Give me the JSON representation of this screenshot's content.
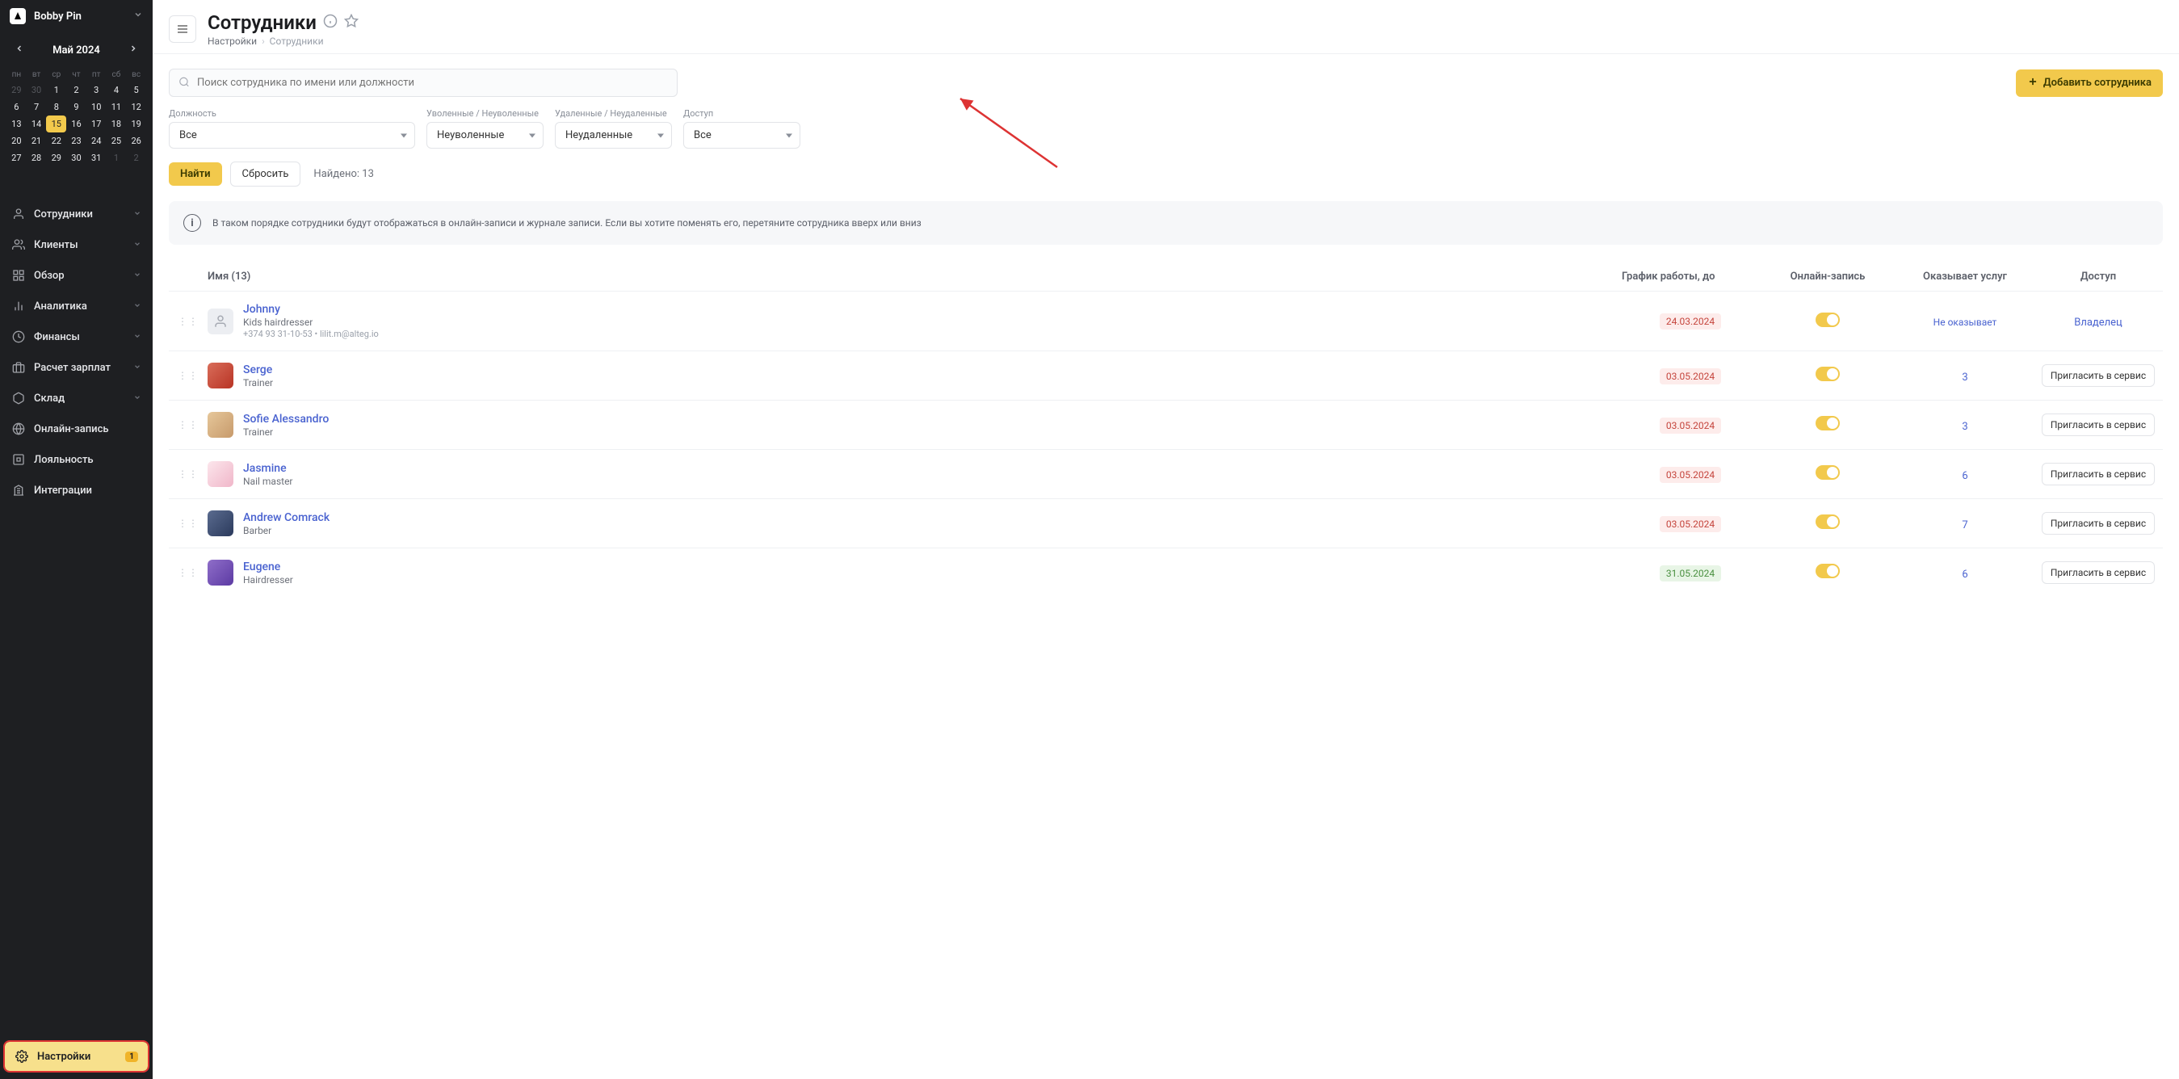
{
  "brand": "Bobby Pin",
  "calendar": {
    "title": "Май 2024",
    "dow": [
      "пн",
      "вт",
      "ср",
      "чт",
      "пт",
      "сб",
      "вс"
    ],
    "days": [
      {
        "d": "29",
        "mute": true
      },
      {
        "d": "30",
        "mute": true
      },
      {
        "d": "1"
      },
      {
        "d": "2"
      },
      {
        "d": "3"
      },
      {
        "d": "4"
      },
      {
        "d": "5"
      },
      {
        "d": "6"
      },
      {
        "d": "7"
      },
      {
        "d": "8"
      },
      {
        "d": "9"
      },
      {
        "d": "10"
      },
      {
        "d": "11"
      },
      {
        "d": "12"
      },
      {
        "d": "13"
      },
      {
        "d": "14"
      },
      {
        "d": "15",
        "today": true
      },
      {
        "d": "16"
      },
      {
        "d": "17"
      },
      {
        "d": "18"
      },
      {
        "d": "19"
      },
      {
        "d": "20"
      },
      {
        "d": "21"
      },
      {
        "d": "22"
      },
      {
        "d": "23"
      },
      {
        "d": "24"
      },
      {
        "d": "25"
      },
      {
        "d": "26"
      },
      {
        "d": "27"
      },
      {
        "d": "28"
      },
      {
        "d": "29"
      },
      {
        "d": "30"
      },
      {
        "d": "31"
      },
      {
        "d": "1",
        "mute": true
      },
      {
        "d": "2",
        "mute": true
      }
    ]
  },
  "nav": [
    {
      "label": "Сотрудники",
      "chev": true
    },
    {
      "label": "Клиенты",
      "chev": true
    },
    {
      "label": "Обзор",
      "chev": true
    },
    {
      "label": "Аналитика",
      "chev": true
    },
    {
      "label": "Финансы",
      "chev": true
    },
    {
      "label": "Расчет зарплат",
      "chev": true
    },
    {
      "label": "Склад",
      "chev": true
    },
    {
      "label": "Онлайн-запись",
      "chev": false
    },
    {
      "label": "Лояльность",
      "chev": false
    },
    {
      "label": "Интеграции",
      "chev": false
    }
  ],
  "settings": {
    "label": "Настройки",
    "badge": "1"
  },
  "page": {
    "title": "Сотрудники",
    "crumb1": "Настройки",
    "crumb2": "Сотрудники"
  },
  "search": {
    "placeholder": "Поиск сотрудника по имени или должности"
  },
  "add_button": "Добавить сотрудника",
  "filters": {
    "position_label": "Должность",
    "position_value": "Все",
    "dismissed_label": "Уволенные / Неуволенные",
    "dismissed_value": "Неуволенные",
    "deleted_label": "Удаленные / Неудаленные",
    "deleted_value": "Неудаленные",
    "access_label": "Доступ",
    "access_value": "Все"
  },
  "actions": {
    "find": "Найти",
    "reset": "Сбросить",
    "found": "Найдено: 13"
  },
  "info": "В таком порядке сотрудники будут отображаться в онлайн-записи и журнале записи. Если вы хотите поменять его, перетяните сотрудника вверх или вниз",
  "thead": {
    "name": "Имя (13)",
    "schedule": "График работы, до",
    "online": "Онлайн-запись",
    "services": "Оказывает услуг",
    "access": "Доступ"
  },
  "invite_label": "Пригласить в сервис",
  "rows": [
    {
      "name": "Johnny",
      "role": "Kids hairdresser",
      "contacts": "+374 93 31-10-53 • lilit.m@alteg.io",
      "date": "24.03.2024",
      "date_cls": "red",
      "svc": "Не оказывает",
      "access": "Владелец",
      "avatar": ""
    },
    {
      "name": "Serge",
      "role": "Trainer",
      "contacts": "",
      "date": "03.05.2024",
      "date_cls": "red",
      "svc": "3",
      "access": "invite",
      "avatar": "c1"
    },
    {
      "name": "Sofie Alessandro",
      "role": "Trainer",
      "contacts": "",
      "date": "03.05.2024",
      "date_cls": "red",
      "svc": "3",
      "access": "invite",
      "avatar": "c2"
    },
    {
      "name": "Jasmine",
      "role": "Nail master",
      "contacts": "",
      "date": "03.05.2024",
      "date_cls": "red",
      "svc": "6",
      "access": "invite",
      "avatar": "c3"
    },
    {
      "name": "Andrew Comrack",
      "role": "Barber",
      "contacts": "",
      "date": "03.05.2024",
      "date_cls": "red",
      "svc": "7",
      "access": "invite",
      "avatar": "c4"
    },
    {
      "name": "Eugene",
      "role": "Hairdresser",
      "contacts": "",
      "date": "31.05.2024",
      "date_cls": "green",
      "svc": "6",
      "access": "invite",
      "avatar": "c5"
    }
  ]
}
